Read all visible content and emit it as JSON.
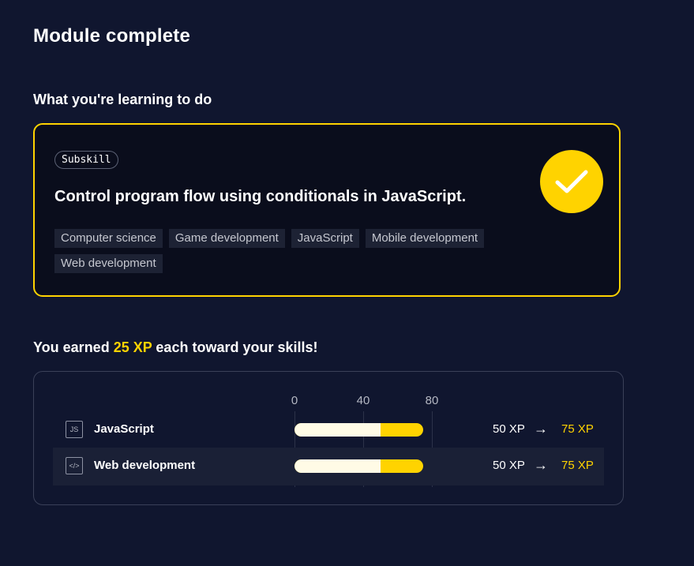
{
  "page": {
    "title": "Module complete"
  },
  "learning": {
    "label": "What you're learning to do",
    "badge": "Subskill",
    "title": "Control program flow using conditionals in JavaScript.",
    "tags": [
      "Computer science",
      "Game development",
      "JavaScript",
      "Mobile development",
      "Web development"
    ],
    "status_icon": "checkmark-icon",
    "accent_color": "#ffd300"
  },
  "xp": {
    "heading_prefix": "You earned ",
    "heading_amount": "25 XP",
    "heading_suffix": " each toward your skills!",
    "axis_ticks": [
      "0",
      "40",
      "80"
    ],
    "axis_max": 80,
    "skills": [
      {
        "name": "JavaScript",
        "icon": "js-file-icon",
        "icon_text": "JS",
        "before_value": 50,
        "after_value": 75,
        "before": "50 XP",
        "after": "75 XP",
        "arrow": "→"
      },
      {
        "name": "Web development",
        "icon": "code-window-icon",
        "icon_text": "</>",
        "before_value": 50,
        "after_value": 75,
        "before": "50 XP",
        "after": "75 XP",
        "arrow": "→"
      }
    ]
  }
}
